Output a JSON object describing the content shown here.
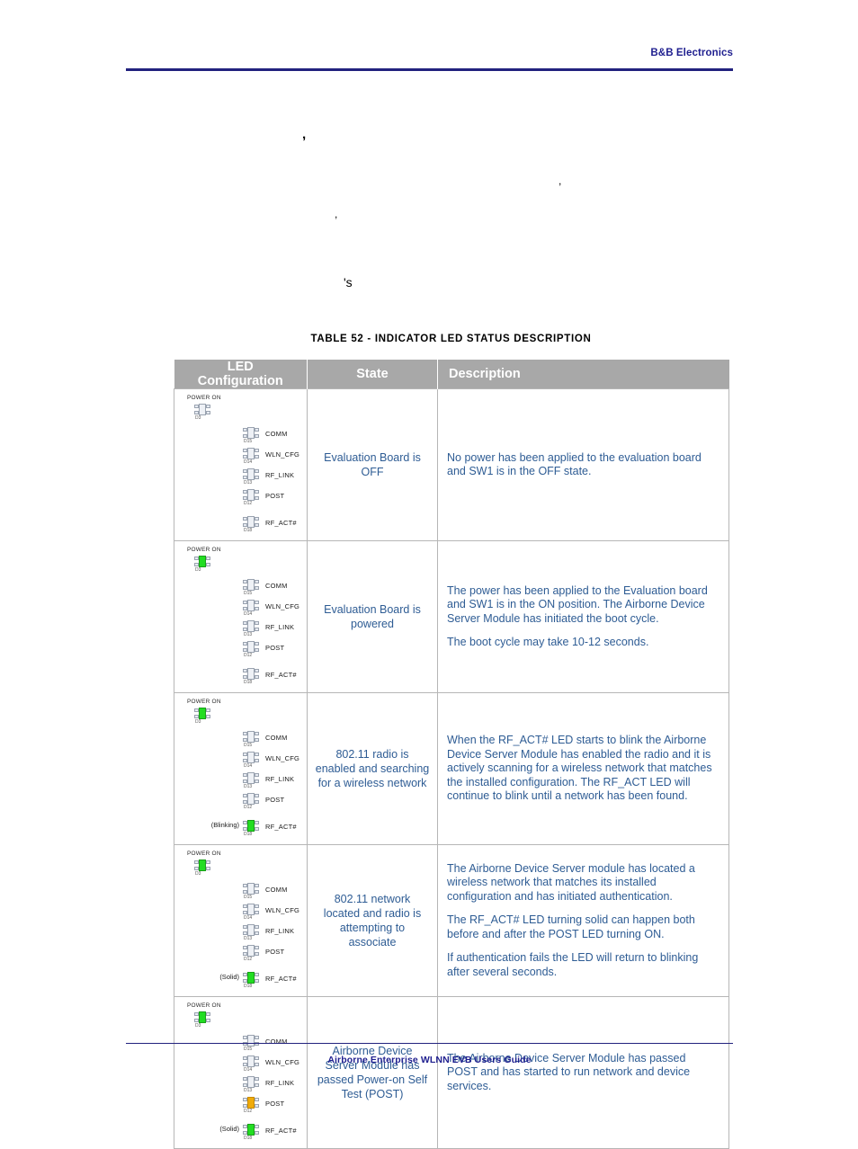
{
  "header": {
    "company": "B&B Electronics"
  },
  "artifacts": {
    "mark1": ",",
    "mark2": ",",
    "mark3": ",",
    "mark4": "'s"
  },
  "caption": "TABLE 52  - INDICATOR LED STATUS DESCRIPTION",
  "table": {
    "columns": [
      "LED Configuration",
      "State",
      "Description"
    ],
    "led_labels": {
      "power": "POWER ON",
      "power_ref": "D3",
      "items": [
        {
          "name": "COMM",
          "ref": "D15"
        },
        {
          "name": "WLN_CFG",
          "ref": "D14"
        },
        {
          "name": "RF_LINK",
          "ref": "D13"
        },
        {
          "name": "POST",
          "ref": "D12"
        },
        {
          "name": "RF_ACT#",
          "ref": "D18"
        }
      ]
    },
    "rows": [
      {
        "leds": {
          "power": "off",
          "comm": "off",
          "wln_cfg": "off",
          "rf_link": "off",
          "post": "off",
          "rf_act": "off",
          "rf_act_note": ""
        },
        "state": "Evaluation Board is OFF",
        "description": [
          "No power has been applied to the evaluation board and SW1 is in the OFF state."
        ]
      },
      {
        "leds": {
          "power": "green",
          "comm": "off",
          "wln_cfg": "off",
          "rf_link": "off",
          "post": "off",
          "rf_act": "off",
          "rf_act_note": ""
        },
        "state": "Evaluation Board is powered",
        "description": [
          "The power has been applied to the Evaluation board and SW1 is in the ON position. The Airborne Device Server Module has initiated the boot cycle.",
          "The boot cycle may take 10-12 seconds."
        ]
      },
      {
        "leds": {
          "power": "green",
          "comm": "off",
          "wln_cfg": "off",
          "rf_link": "off",
          "post": "off",
          "rf_act": "green",
          "rf_act_note": "(Blinking)"
        },
        "state": "802.11 radio is enabled and searching for a wireless network",
        "description": [
          "When the RF_ACT# LED starts to blink the Airborne Device Server Module has enabled the radio and it is actively scanning for a wireless network that matches the installed configuration. The RF_ACT LED will continue to blink until a network has been found."
        ]
      },
      {
        "leds": {
          "power": "green",
          "comm": "off",
          "wln_cfg": "off",
          "rf_link": "off",
          "post": "off",
          "rf_act": "green",
          "rf_act_note": "(Solid)"
        },
        "state": "802.11 network located and radio is attempting to associate",
        "description": [
          "The Airborne Device Server module has located a wireless network that matches its installed configuration and has initiated authentication.",
          "The RF_ACT# LED turning solid can happen both before and after the POST LED turning ON.",
          "If authentication fails the LED will return to blinking after several seconds."
        ]
      },
      {
        "leds": {
          "power": "green",
          "comm": "off",
          "wln_cfg": "off",
          "rf_link": "off",
          "post": "amber",
          "rf_act": "green",
          "rf_act_note": "(Solid)"
        },
        "state": "Airborne Device Server Module has passed Power-on Self Test (POST)",
        "description": [
          "The Airborne Device Server Module has passed POST and has started to run network and device services."
        ]
      }
    ]
  },
  "footer": {
    "title": "Airborne Enterprise WLNN EVB Users Guide"
  },
  "colors": {
    "brand_blue": "#22227e",
    "text_blue": "#2e5c94",
    "header_gray": "#a8a8a8",
    "led_green": "#22dd22",
    "led_amber": "#f0ab0a",
    "led_off": "#eef1f6"
  }
}
